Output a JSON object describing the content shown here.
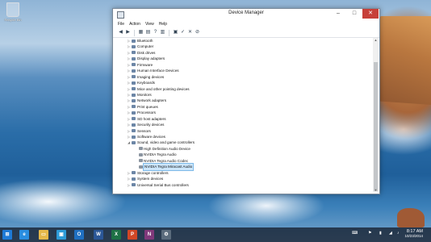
{
  "desktop": {
    "recycle_bin_label": "Recycle Bin"
  },
  "window": {
    "title": "Device Manager",
    "controls": {
      "minimize": "–",
      "maximize": "□",
      "close": "✕"
    },
    "menu": [
      "File",
      "Action",
      "View",
      "Help"
    ],
    "toolbar_icons": [
      "back-icon",
      "forward-icon",
      "properties-icon",
      "show-hide-icon",
      "help-icon",
      "device-icon",
      "update-driver-icon",
      "uninstall-icon",
      "scan-icon",
      "disable-icon"
    ]
  },
  "tree": {
    "items": [
      {
        "label": "Bluetooth",
        "expanded": false,
        "child": false,
        "icon": "bluetooth-icon"
      },
      {
        "label": "Computer",
        "expanded": false,
        "child": false,
        "icon": "computer-icon"
      },
      {
        "label": "Disk drives",
        "expanded": false,
        "child": false,
        "icon": "disk-icon"
      },
      {
        "label": "Display adapters",
        "expanded": false,
        "child": false,
        "icon": "display-icon"
      },
      {
        "label": "Firmware",
        "expanded": false,
        "child": false,
        "icon": "firmware-icon"
      },
      {
        "label": "Human Interface Devices",
        "expanded": false,
        "child": false,
        "icon": "hid-icon"
      },
      {
        "label": "Imaging devices",
        "expanded": false,
        "child": false,
        "icon": "camera-icon"
      },
      {
        "label": "Keyboards",
        "expanded": false,
        "child": false,
        "icon": "keyboard-icon"
      },
      {
        "label": "Mice and other pointing devices",
        "expanded": false,
        "child": false,
        "icon": "mouse-icon"
      },
      {
        "label": "Monitors",
        "expanded": false,
        "child": false,
        "icon": "monitor-icon"
      },
      {
        "label": "Network adapters",
        "expanded": false,
        "child": false,
        "icon": "network-icon"
      },
      {
        "label": "Print queues",
        "expanded": false,
        "child": false,
        "icon": "printer-icon"
      },
      {
        "label": "Processors",
        "expanded": false,
        "child": false,
        "icon": "processor-icon"
      },
      {
        "label": "SD host adapters",
        "expanded": false,
        "child": false,
        "icon": "sd-icon"
      },
      {
        "label": "Security devices",
        "expanded": false,
        "child": false,
        "icon": "security-icon"
      },
      {
        "label": "Sensors",
        "expanded": false,
        "child": false,
        "icon": "sensor-icon"
      },
      {
        "label": "Software devices",
        "expanded": false,
        "child": false,
        "icon": "software-icon"
      },
      {
        "label": "Sound, video and game controllers",
        "expanded": true,
        "child": false,
        "icon": "sound-icon"
      },
      {
        "label": "High Definition Audio Device",
        "expanded": false,
        "child": true,
        "icon": "speaker-icon"
      },
      {
        "label": "NVIDIA Tegra Audio",
        "expanded": false,
        "child": true,
        "icon": "speaker-icon"
      },
      {
        "label": "NVIDIA Tegra Audio Codec",
        "expanded": false,
        "child": true,
        "icon": "speaker-icon"
      },
      {
        "label": "NVIDIA Tegra Miracast Audio",
        "expanded": false,
        "child": true,
        "icon": "speaker-icon",
        "selected": true
      },
      {
        "label": "Storage controllers",
        "expanded": false,
        "child": false,
        "icon": "storage-icon"
      },
      {
        "label": "System devices",
        "expanded": false,
        "child": false,
        "icon": "system-icon"
      },
      {
        "label": "Universal Serial Bus controllers",
        "expanded": false,
        "child": false,
        "icon": "usb-icon"
      }
    ]
  },
  "taskbar": {
    "apps": [
      {
        "name": "start-icon",
        "glyph": "⊞",
        "color": "#1e7ad6"
      },
      {
        "name": "ie-icon",
        "glyph": "e",
        "color": "#2a8ee0"
      },
      {
        "name": "explorer-icon",
        "glyph": "▭",
        "color": "#e6b84a"
      },
      {
        "name": "store-icon",
        "glyph": "▣",
        "color": "#2d9bd8"
      },
      {
        "name": "outlook-icon",
        "glyph": "O",
        "color": "#1f6fc0"
      },
      {
        "name": "word-icon",
        "glyph": "W",
        "color": "#2b5797"
      },
      {
        "name": "excel-icon",
        "glyph": "X",
        "color": "#1e7145"
      },
      {
        "name": "powerpoint-icon",
        "glyph": "P",
        "color": "#d24726"
      },
      {
        "name": "onenote-icon",
        "glyph": "N",
        "color": "#80397b"
      },
      {
        "name": "device-manager-icon",
        "glyph": "⚙",
        "color": "#5a6b7c"
      }
    ],
    "clock_time": "8:17 AM",
    "clock_date": "10/23/2014"
  },
  "colors": {
    "close_button": "#c7403a",
    "selection": "#cce6fb",
    "taskbar": "#141e2d"
  }
}
